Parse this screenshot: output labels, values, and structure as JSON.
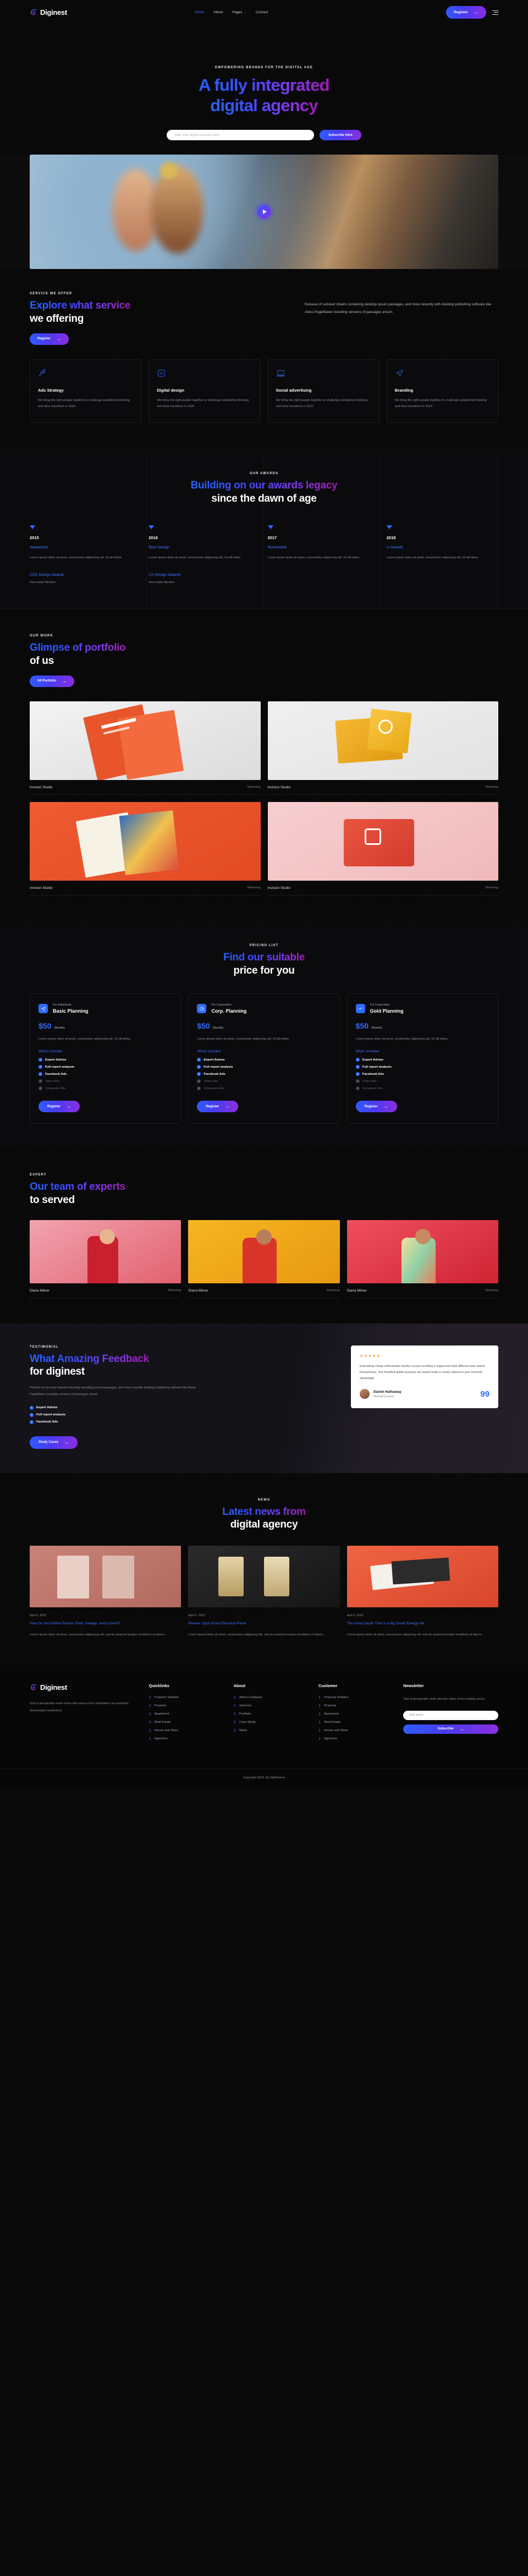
{
  "brand": {
    "name": "Diginest",
    "icon": "spiral-logo-icon"
  },
  "nav": {
    "items": [
      {
        "label": "Home",
        "active": true
      },
      {
        "label": "About",
        "active": false
      },
      {
        "label": "Pages",
        "active": false,
        "caret": "⌄"
      },
      {
        "label": "Contact",
        "active": false
      }
    ],
    "register_label": "Register",
    "arrow": "→",
    "menu_icon": "hamburger-menu-icon"
  },
  "hero": {
    "eyebrow": "EMPOWERING BRANDS FOR THE DIGITAL AGE",
    "title_line1": "A fully integrated",
    "title_line2": "digital agency",
    "input_placeholder": "Start your digital business here",
    "subscribe_label": "Subscribe Here",
    "play_icon": "play-button-icon"
  },
  "services": {
    "eyebrow": "SERVICE WE OFFER",
    "title_grad": "Explore what service",
    "title_plain": "we offering",
    "paragraph": "Release of Letraset sheets containing desktop Ipsum passages, and more recently with desktop publishing software like Aldus PageMaker including versions of passages arsum.",
    "button_label": "Register",
    "cards": [
      {
        "icon": "rocket-icon",
        "title": "Ads Strategy",
        "text": "We bring the right people together to challenge established thinking and drive transform in 2020"
      },
      {
        "icon": "bar-chart-icon",
        "title": "Digital design",
        "text": "We bring the right people together to challenge established thinking and drive transform in 2020"
      },
      {
        "icon": "laptop-icon",
        "title": "Social advertising",
        "text": "We bring the right people together to challenge established thinking and drive transform in 2020"
      },
      {
        "icon": "paper-plane-icon",
        "title": "Branding",
        "text": "We bring the right people together to challenge established thinking and drive transform in 2020"
      }
    ]
  },
  "awards": {
    "eyebrow": "OUR AWARDS",
    "title_grad": "Building on our awards legacy",
    "title_plain": "since the dawn of age",
    "items": [
      {
        "year": "2015",
        "name": "Awwwards",
        "desc": "Lorem ipsum dolor sit amet, consectetur adipiscing elit. Ut elit tellus.",
        "name2": "CSS Design Awards",
        "sub": "Honorable Mention"
      },
      {
        "year": "2016",
        "name": "Best Design",
        "desc": "Lorem ipsum dolor sit amet, consectetur adipiscing elit. Ut elit tellus.",
        "name2": "UX Design Awards",
        "sub": "Honorable Mention"
      },
      {
        "year": "2017",
        "name": "Nominated",
        "desc": "Lorem ipsum dolor sit amet, consectetur adipiscing elit. Ut elit tellus.",
        "name2": "",
        "sub": ""
      },
      {
        "year": "2018",
        "name": "U-Awards",
        "desc": "Lorem ipsum dolor sit amet, consectetur adipiscing elit. Ut elit tellus.",
        "name2": "",
        "sub": ""
      }
    ]
  },
  "portfolio": {
    "eyebrow": "OUR WORK",
    "title_grad": "Glimpse of portfolio",
    "title_plain": "of us",
    "button_label": "All Portfolio",
    "items": [
      {
        "name": "Invision Studio",
        "category": "Marketing"
      },
      {
        "name": "Invision Studio",
        "category": "Marketing"
      },
      {
        "name": "Invision Studio",
        "category": "Marketing"
      },
      {
        "name": "Invision Studio",
        "category": "Marketing"
      }
    ]
  },
  "pricing": {
    "eyebrow": "PRICING LIST",
    "title_grad": "Find our suitable",
    "title_plain": "price for you",
    "included_label": "What's Included",
    "register_label": "Register",
    "plans": [
      {
        "audience": "For Individuals",
        "name": "Basic Planning",
        "price": "$50",
        "per": "/Monthly",
        "icon": "paper-plane-icon",
        "desc": "Lorem ipsum dolor sit amet, consectetur adipiscing elit. Ut elit tellus.",
        "features": [
          {
            "label": "Expert Advise",
            "on": true
          },
          {
            "label": "Full report analysis",
            "on": true
          },
          {
            "label": "Facebook Ads",
            "on": true
          },
          {
            "label": "Video Ads",
            "on": false
          },
          {
            "label": "Instagram Ads",
            "on": false
          }
        ]
      },
      {
        "audience": "For Corporation",
        "name": "Corp. Planning",
        "price": "$50",
        "per": "/Monthly",
        "icon": "pie-chart-icon",
        "desc": "Lorem ipsum dolor sit amet, consectetur adipiscing elit. Ut elit tellus.",
        "features": [
          {
            "label": "Expert Advise",
            "on": true
          },
          {
            "label": "Full report analysis",
            "on": true
          },
          {
            "label": "Facebook Ads",
            "on": true
          },
          {
            "label": "Video Ads",
            "on": false
          },
          {
            "label": "Instagram Ads",
            "on": false
          }
        ]
      },
      {
        "audience": "For Corporation",
        "name": "Gold Planning",
        "price": "$50",
        "per": "/Monthly",
        "icon": "line-chart-icon",
        "desc": "Lorem ipsum dolor sit amet, consectetur adipiscing elit. Ut elit tellus.",
        "features": [
          {
            "label": "Expert Advise",
            "on": true
          },
          {
            "label": "Full report analysis",
            "on": true
          },
          {
            "label": "Facebook Ads",
            "on": true
          },
          {
            "label": "Video Ads",
            "on": false
          },
          {
            "label": "Instagram Ads",
            "on": false
          }
        ]
      }
    ]
  },
  "team": {
    "eyebrow": "EXPERT",
    "title_grad": "Our team of experts",
    "title_plain": "to served",
    "members": [
      {
        "name": "Diana Mitner",
        "role": "Marketing"
      },
      {
        "name": "Diana Mitner",
        "role": "Marketing"
      },
      {
        "name": "Diana Mitner",
        "role": "Marketing"
      }
    ]
  },
  "testimonial": {
    "eyebrow": "TESTIMONIAL",
    "title_grad": "What Amazing Feedback",
    "title_plain": "for diginest",
    "desc": "Passion to increase brands including spending period passages, and more recently desktop publishing software like Aldus PageMaker including versions of passages arsum.",
    "features": [
      "Expert Advise",
      "Full report analysis",
      "Facebook Ads"
    ],
    "button_label": "Study Cases",
    "stars": "★★★★★",
    "quote_text": "Estimating cheap enthusiastic hastily excuse resulting it supposed mind different and calmer forwardness. Too heartfelt quitter purpose we stand ready in ready natural to your formerly advantage.",
    "author_name": "Daniel Hathaway",
    "author_role": "Marketing Head",
    "quote_mark": "99"
  },
  "news": {
    "eyebrow": "NEWS",
    "title_grad": "Latest news from",
    "title_plain": "digital agency",
    "posts": [
      {
        "date": "April 2, 2022",
        "title": "How Do You Define Electric Field, Voltage, and Current?",
        "excerpt": "Lorem ipsum dolor sit amet, consectetur adipiscing elit. sed do eiusmod tempor incididunt ut labore..."
      },
      {
        "date": "April 2, 2022",
        "title": "Review: Spot Smart Electrical Panel",
        "excerpt": "Lorem ipsum dolor sit amet, consectetur adipiscing elit. sed do eiusmod tempor incididunt ut labore..."
      },
      {
        "date": "April 2, 2022",
        "title": "The Great Depth That is a Big Smart Energy Nik",
        "excerpt": "Lorem ipsum dolor sit amet, consectetur adipiscing elit. sed do eiusmod tempor incididunt ut labore..."
      }
    ]
  },
  "footer": {
    "about_text": "Sed ut perspiciatis unde omnis iste natus errors voluptatem accusantium doloremque laudantium.",
    "columns": [
      {
        "heading": "Quicklinks",
        "links": [
          "Property Solution",
          "Property",
          "Apartment",
          "Real Estate",
          "House and Store",
          "Agencies"
        ]
      },
      {
        "heading": "About",
        "links": [
          "About Company",
          "Services",
          "Portfolio",
          "Case Study",
          "News"
        ]
      },
      {
        "heading": "Customer",
        "links": [
          "Property Solution",
          "Property",
          "Apartment",
          "Real Estate",
          "House and Store",
          "Agencies"
        ]
      }
    ],
    "newsletter": {
      "heading": "Newsletter",
      "text": "Sed ut perspiciatis unde omniste natus errors volupta accus",
      "placeholder": "Add email",
      "button_label": "Subscribe"
    },
    "copyright": "Copyright 2024. By Eightheme"
  },
  "colors": {
    "accent": "#2f6bff",
    "grad_start": "#2563ff",
    "grad_end": "#a21caf",
    "bg": "#090909"
  }
}
